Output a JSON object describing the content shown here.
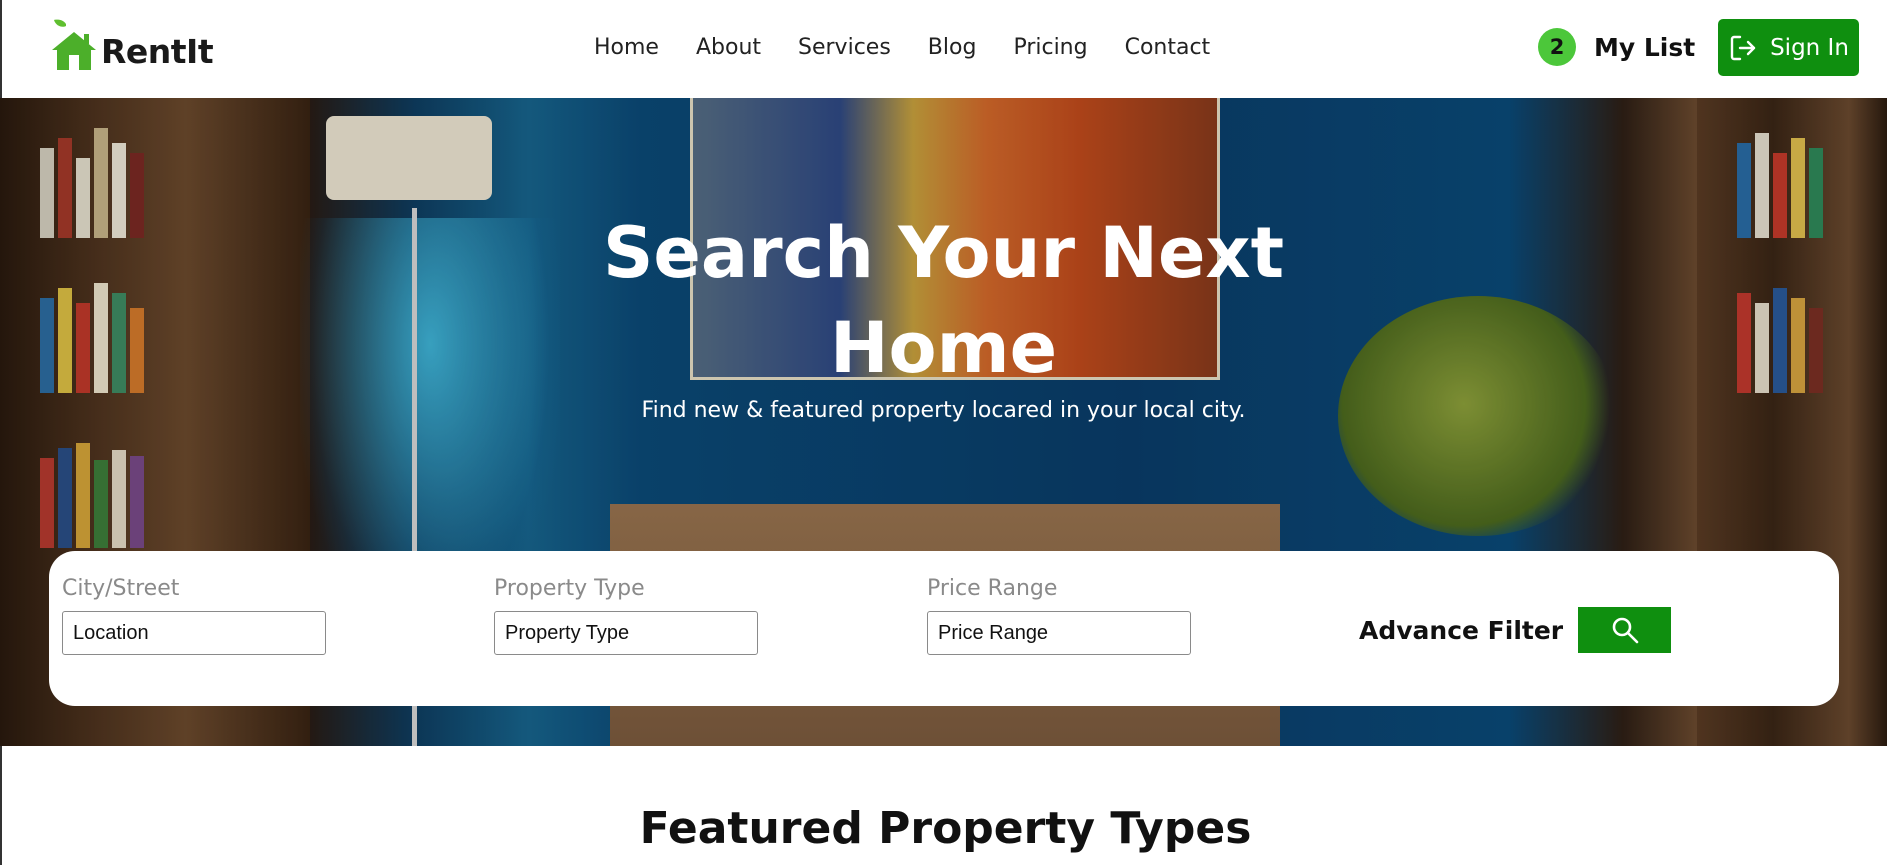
{
  "brand": {
    "logo_text": "RentIt"
  },
  "nav": {
    "items": [
      {
        "label": "Home"
      },
      {
        "label": "About"
      },
      {
        "label": "Services"
      },
      {
        "label": "Blog"
      },
      {
        "label": "Pricing"
      },
      {
        "label": "Contact"
      }
    ]
  },
  "my_list": {
    "count": "2",
    "label": "My List"
  },
  "sign_in": {
    "label": "Sign In",
    "icon": "sign-in-icon"
  },
  "hero": {
    "title_line1": "Search Your Next",
    "title_line2": "Home",
    "subtitle": "Find new & featured property locared in your local city."
  },
  "search": {
    "fields": [
      {
        "label": "City/Street",
        "placeholder": "Location"
      },
      {
        "label": "Property Type",
        "placeholder": "Property Type"
      },
      {
        "label": "Price Range",
        "placeholder": "Price Range"
      }
    ],
    "advance_filter_label": "Advance Filter",
    "search_icon": "search-icon"
  },
  "featured": {
    "title": "Featured Property Types"
  },
  "colors": {
    "accent": "#0f8f0f",
    "badge": "#4cc73a",
    "text": "#111111"
  }
}
